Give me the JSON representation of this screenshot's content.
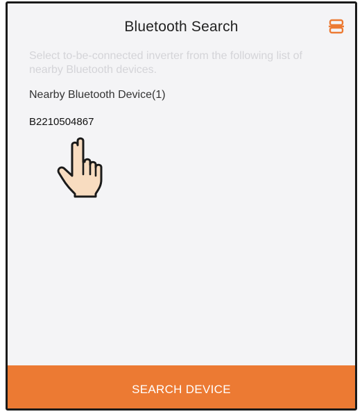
{
  "header": {
    "title": "Bluetooth Search",
    "scan_icon": "scan-icon"
  },
  "hint_text": "Select to-be-connected inverter from the following list of nearby Bluetooth devices.",
  "device_list": {
    "label": "Nearby Bluetooth Device(1)",
    "items": [
      {
        "name": "B2210504867"
      }
    ]
  },
  "pointer_icon": "hand-pointer-icon",
  "footer": {
    "search_label": "SEARCH DEVICE"
  },
  "colors": {
    "accent": "#ec7a33",
    "background": "#f4f4f6",
    "hint_text": "#d4d4d8"
  }
}
